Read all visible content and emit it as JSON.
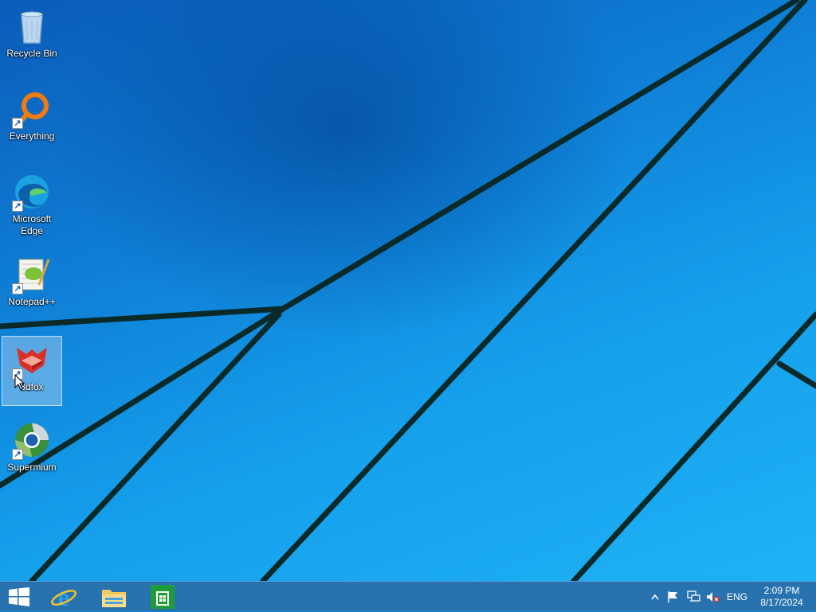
{
  "desktop": {
    "icons": [
      {
        "label": "Recycle Bin",
        "icon": "recycle-bin-icon"
      },
      {
        "label": "Everything",
        "icon": "everything-icon"
      },
      {
        "label": "Microsoft Edge",
        "icon": "edge-icon"
      },
      {
        "label": "Notepad++",
        "icon": "notepadpp-icon"
      },
      {
        "label": "3dfox",
        "icon": "3dfox-icon",
        "selected": true
      },
      {
        "label": "Supermium",
        "icon": "supermium-icon"
      }
    ]
  },
  "taskbar": {
    "start_icon": "windows-start-icon",
    "pinned": [
      {
        "icon": "internet-explorer-icon"
      },
      {
        "icon": "file-explorer-icon"
      },
      {
        "icon": "store-icon"
      }
    ],
    "tray": {
      "icons": [
        "show-hidden-icons-chevron",
        "action-center-flag-icon",
        "network-icon",
        "volume-muted-icon"
      ],
      "language": "ENG",
      "time": "2:09 PM",
      "date": "8/17/2024"
    }
  },
  "colors": {
    "accent": "#0f7fd6",
    "taskbar": "#2d6eaa",
    "wallpaper_line": "#062a2a"
  }
}
